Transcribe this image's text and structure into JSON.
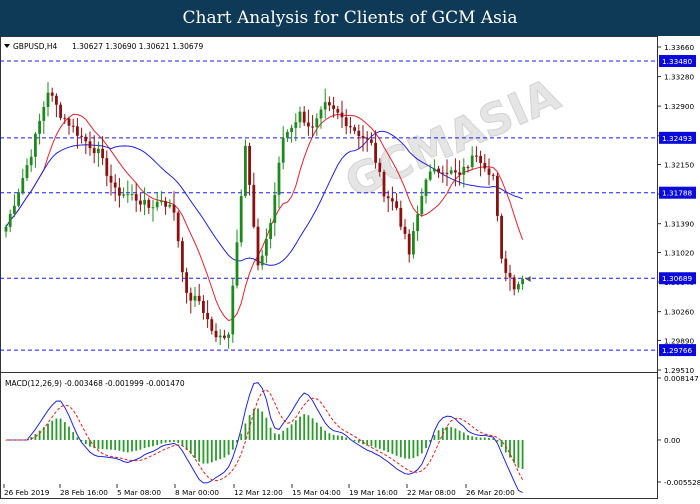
{
  "banner": {
    "title": "Chart Analysis for Clients of GCM Asia"
  },
  "main_chart": {
    "symbol": "GBPUSD,H4",
    "ohlc": "1.30627 1.30690 1.30621 1.30679",
    "ylim": [
      1.2951,
      1.3375
    ],
    "price_ticks": [
      "1.33660",
      "1.33280",
      "1.32900",
      "1.32520",
      "1.32150",
      "1.31770",
      "1.31390",
      "1.31020",
      "1.30640",
      "1.30260",
      "1.29890",
      "1.29510"
    ],
    "level_labels": [
      "1.33480",
      "1.32493",
      "1.31788",
      "1.30689",
      "1.29766"
    ],
    "level_values": [
      1.3348,
      1.32493,
      1.31788,
      1.30689,
      1.29766
    ],
    "current_price": "1.30679",
    "watermark": "GCMASIA"
  },
  "macd": {
    "title": "MACD(12,26,9) -0.003468 -0.001999 -0.001470",
    "ticks": [
      "0.008147",
      "0.00",
      "-0.005528"
    ]
  },
  "time_axis": {
    "labels": [
      "26 Feb 2019",
      "28 Feb 16:00",
      "5 Mar 08:00",
      "8 Mar 00:00",
      "12 Mar 12:00",
      "15 Mar 04:00",
      "19 Mar 16:00",
      "22 Mar 08:00",
      "26 Mar 20:00"
    ]
  },
  "colors": {
    "banner_bg": "#0e3a57",
    "bull_candle": "#1e8a1e",
    "bear_candle": "#8b1010",
    "level_line": "#1a1aff",
    "level_label_bg": "#0a0adc",
    "ma_fast": "#e0242f",
    "ma_slow": "#2222dd",
    "macd_hist": "#2a9a2a",
    "macd_signal": "#e02020"
  }
}
